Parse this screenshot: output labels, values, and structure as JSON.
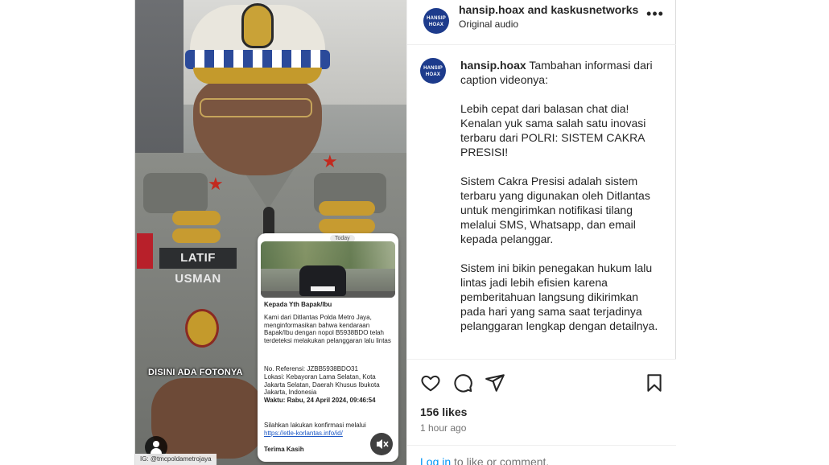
{
  "header": {
    "title": "hansip.hoax and kaskusnetworks",
    "subtitle": "Original audio",
    "avatar_text": "HANSIP HOAX"
  },
  "caption": {
    "username": "hansip.hoax",
    "intro": "Tambahan informasi dari caption videonya:",
    "paragraphs": [
      "Lebih cepat dari balasan chat dia! Kenalan yuk sama salah satu inovasi terbaru dari POLRI: SISTEM CAKRA PRESISI!",
      "Sistem Cakra Presisi adalah sistem terbaru yang digunakan oleh Ditlantas untuk mengirimkan notifikasi tilang melalui SMS, Whatsapp, dan email kepada pelanggar.",
      "Sistem ini bikin penegakan hukum lalu lintas jadi lebih efisien karena pemberitahuan langsung dikirimkan pada hari yang sama saat terjadinya pelanggaran lengkap dengan detailnya."
    ]
  },
  "stats": {
    "likes": "156 likes",
    "time": "1 hour ago"
  },
  "footer": {
    "login_link": "Log in",
    "login_rest": "to like or comment."
  },
  "media": {
    "overlay_text": "DISINI ADA FOTONYA",
    "nameplate": "LATIF USMAN",
    "credit": "IG: @tmcpoldametrojaya",
    "phone": {
      "today": "Today",
      "greeting": "Kepada Yth Bapak/Ibu",
      "body": "Kami dari Ditlantas Polda Metro Jaya, menginformasikan bahwa kendaraan Bapak/Ibu dengan nopol B5938BDO telah terdeteksi melakukan pelanggaran lalu lintas",
      "ref": "No. Referensi: JZBB5938BDO31",
      "location": "Lokasi: Kebayoran Lama Selatan, Kota Jakarta Selatan, Daerah Khusus Ibukota Jakarta, Indonesia",
      "time": "Waktu: Rabu, 24 April 2024, 09:46:54",
      "confirm": "Silahkan lakukan konfirmasi melalui",
      "link": "https://etle-korlantas.info/id/",
      "thanks": "Terima Kasih"
    }
  },
  "icons": {
    "like": "heart-icon",
    "comment": "comment-icon",
    "share": "send-icon",
    "save": "bookmark-icon",
    "more": "more-dots-icon",
    "mute": "muted-speaker-icon",
    "user": "user-icon"
  },
  "colors": {
    "link": "#0095f6",
    "text": "#262626",
    "muted": "#737373",
    "avatar": "#1d3b8c"
  }
}
